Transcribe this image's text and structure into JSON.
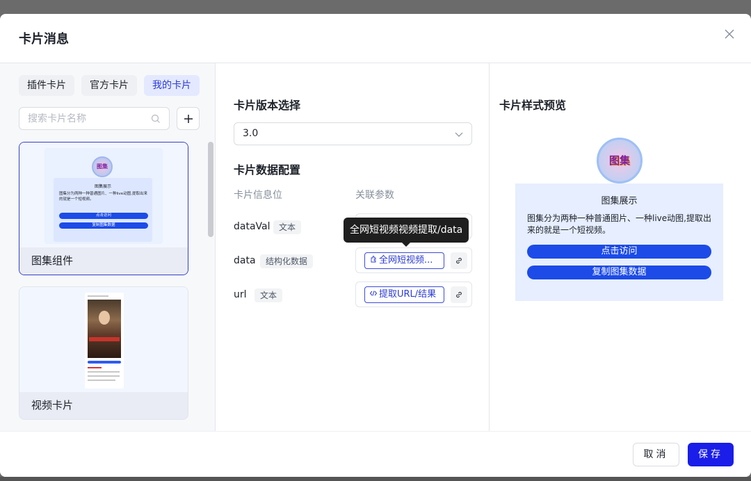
{
  "modal": {
    "title": "卡片消息"
  },
  "left": {
    "tabs": [
      {
        "label": "插件卡片"
      },
      {
        "label": "官方卡片"
      },
      {
        "label": "我的卡片"
      }
    ],
    "search": {
      "placeholder": "搜索卡片名称",
      "value": ""
    },
    "cards": [
      {
        "label": "图集组件",
        "thumb": {
          "avatar_text": "图集",
          "title": "图集展示",
          "desc": "图集分为两种一种普通图片、一种live动图,提取出来的就是一个短视频。",
          "buttons": [
            "点击访问",
            "复制图集数据"
          ]
        }
      },
      {
        "label": "视频卡片"
      }
    ]
  },
  "center": {
    "version_title": "卡片版本选择",
    "version_value": "3.0",
    "data_title": "卡片数据配置",
    "col_info": "卡片信息位",
    "col_param": "关联参数",
    "rows": [
      {
        "name": "dataVal",
        "type": "文本",
        "param": ""
      },
      {
        "name": "data",
        "type": "结构化数据",
        "param": "全网短视频..."
      },
      {
        "name": "url",
        "type": "文本",
        "param": "提取URL/结果"
      }
    ],
    "tooltip": "全网短视频视频提取/data"
  },
  "right": {
    "title": "卡片样式预览",
    "avatar_text": "图集",
    "card_title": "图集展示",
    "card_desc": "图集分为两种一种普通图片、一种live动图,提取出来的就是一个短视频。",
    "buttons": [
      "点击访问",
      "复制图集数据"
    ]
  },
  "footer": {
    "cancel": "取消",
    "save": "保存"
  },
  "colors": {
    "accent": "#2b3bd6",
    "primary_button": "#1a1ee8",
    "preview_button": "#1c4be8"
  }
}
